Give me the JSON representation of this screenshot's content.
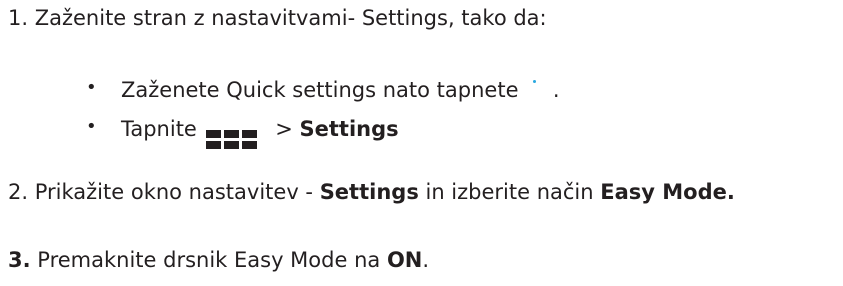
{
  "steps": [
    {
      "number": "1.",
      "text": "Zaženite stran z nastavitvami- Settings, tako da:",
      "sub": [
        {
          "text_before": "Zaženete Quick settings nato tapnete",
          "icon": "quick-settings-dot-icon",
          "text_after": "."
        },
        {
          "text_before": "Tapnite",
          "icon": "apps-grid-icon",
          "text_middle": "> ",
          "bold": "Settings"
        }
      ]
    },
    {
      "number": "2.",
      "text_before": "Prikažite okno nastavitev - ",
      "bold1": "Settings",
      "text_middle": " in izberite način ",
      "bold2": "Easy Mode."
    },
    {
      "number": "3.",
      "text_before": " Premaknite drsnik Easy Mode na ",
      "bold": "ON",
      "text_after": "."
    }
  ],
  "colors": {
    "text": "#231f20",
    "icon_accent": "#29a8e0"
  }
}
